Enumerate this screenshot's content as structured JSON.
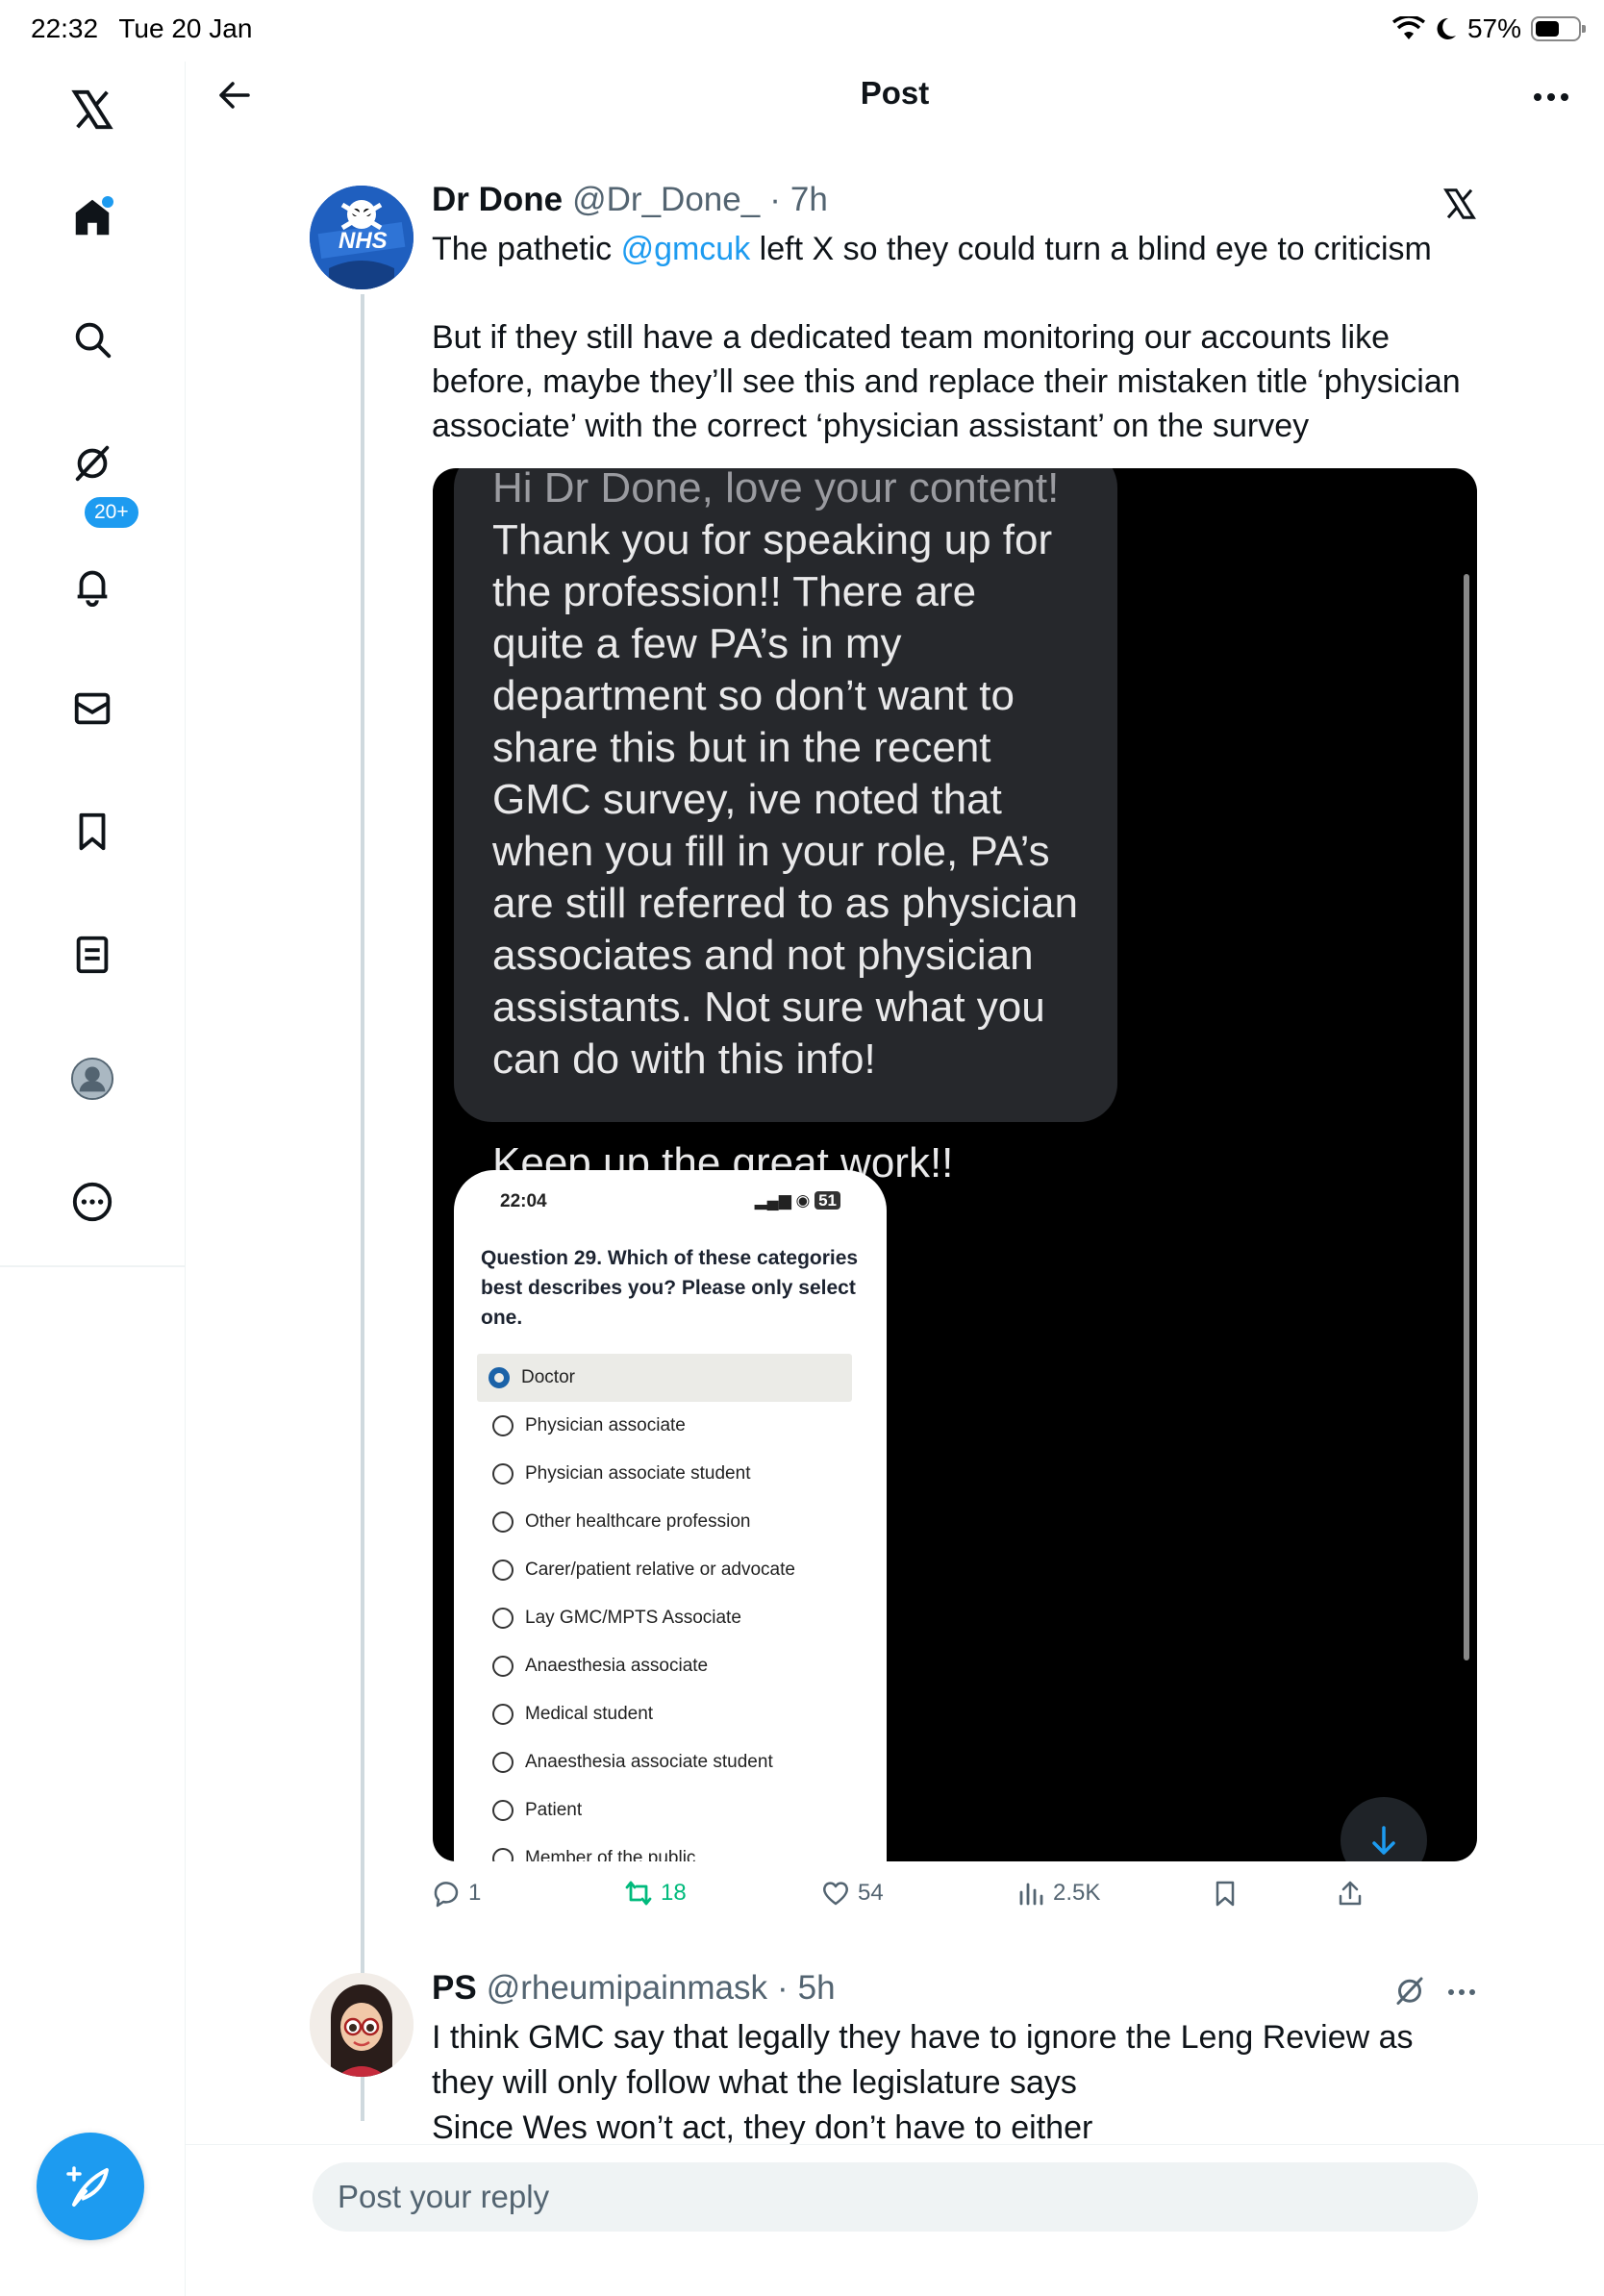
{
  "status_bar": {
    "time": "22:32",
    "date": "Tue 20 Jan",
    "battery": "57%",
    "battery_level": 0.57
  },
  "sidebar": {
    "items": [
      {
        "name": "x-logo-icon"
      },
      {
        "name": "home-icon"
      },
      {
        "name": "search-icon"
      },
      {
        "name": "grok-icon"
      },
      {
        "name": "notifications-icon"
      },
      {
        "name": "messages-icon"
      },
      {
        "name": "bookmarks-icon"
      },
      {
        "name": "lists-icon"
      },
      {
        "name": "profile-icon"
      },
      {
        "name": "more-icon"
      }
    ],
    "notification_badge": "20+",
    "compose_icon": "compose-post-icon"
  },
  "header": {
    "title": "Post",
    "back_icon": "arrow-left-icon",
    "more_icon": "more-horizontal-icon"
  },
  "post": {
    "author_name": "Dr Done",
    "author_handle": "@Dr_Done_",
    "separator": "·",
    "time": "7h",
    "text_line1_pre": "The pathetic ",
    "text_mention": "@gmcuk",
    "text_line1_post": " left X so they could turn a blind eye to criticism",
    "text_para2": "But if they still have a dedicated team monitoring our accounts like before, maybe they’ll see this and replace their mistaken title ‘physician associate’ with the correct ‘physician assistant’ on the survey",
    "avatar_label": "NHS",
    "media": {
      "dm_first_line": "Hi Dr Done, love your content!",
      "dm_body": "Thank you for speaking up for the profession!! There are quite a few PA’s in my department so don’t want to share this but in the recent GMC survey, ive noted that when you fill in your role, PA’s are still referred to as physician associates and not physician assistants. Not sure what you can do with this info!",
      "dm_closing": "Keep up the great work!!",
      "phone_time": "22:04",
      "phone_battery": "51",
      "question": "Question 29.  Which of these categories best describes you? Please only select one.",
      "options": [
        {
          "label": "Doctor",
          "selected": true
        },
        {
          "label": "Physician associate",
          "selected": false
        },
        {
          "label": "Physician associate student",
          "selected": false
        },
        {
          "label": "Other healthcare profession",
          "selected": false
        },
        {
          "label": "Carer/patient relative or advocate",
          "selected": false
        },
        {
          "label": "Lay GMC/MPTS Associate",
          "selected": false
        },
        {
          "label": "Anaesthesia associate",
          "selected": false
        },
        {
          "label": "Medical student",
          "selected": false
        },
        {
          "label": "Anaesthesia associate student",
          "selected": false
        },
        {
          "label": "Patient",
          "selected": false
        },
        {
          "label": "Member of the public",
          "selected": false
        }
      ]
    },
    "stats": {
      "replies": "1",
      "reposts": "18",
      "likes": "54",
      "views": "2.5K"
    }
  },
  "reply": {
    "author_name": "PS",
    "author_handle": "@rheumipainmask",
    "separator": "·",
    "time": "5h",
    "lines": [
      "I think GMC say that legally they have to ignore the Leng Review as they will only follow what the legislature says",
      "Since Wes won’t act, they don’t have to either"
    ]
  },
  "composer": {
    "placeholder": "Post your reply"
  },
  "colors": {
    "accent": "#1d9bf0",
    "repost_green": "#00ba7c",
    "muted": "#536471"
  }
}
